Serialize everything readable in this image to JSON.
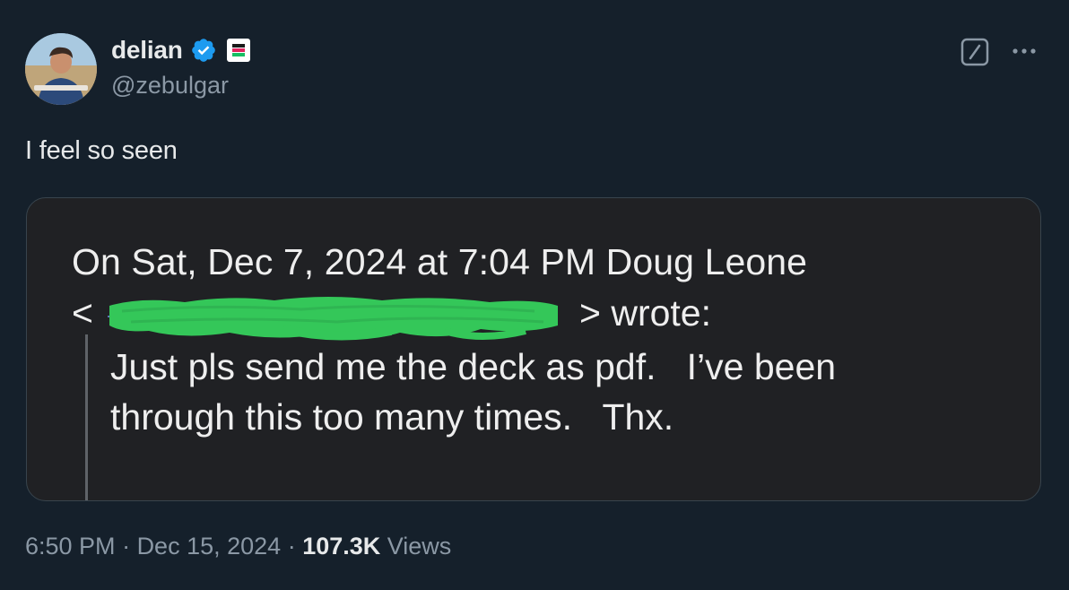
{
  "author": {
    "display_name": "delian",
    "handle": "@zebulgar",
    "verified_icon": "verified-badge-icon",
    "affiliate_icon": "affiliate-badge-icon",
    "avatar_icon": "avatar-photo"
  },
  "actions": {
    "grok_icon": "grok-icon",
    "more_icon": "more-options-icon"
  },
  "tweet": {
    "text": "I feel so seen"
  },
  "media": {
    "email_header": "On Sat, Dec 7, 2024 at 7:04 PM Doug Leone",
    "email_lt": "<",
    "email_gt_wrote": "> wrote:",
    "quote_line_1": "Just pls send me the deck as pdf.   I’ve been",
    "quote_line_2": "through this too many times.   Thx."
  },
  "footer": {
    "time": "6:50 PM",
    "sep1": " · ",
    "date": "Dec 15, 2024",
    "sep2": " · ",
    "views_count": "107.3K",
    "views_label": " Views"
  },
  "colors": {
    "background": "#15202b",
    "primary_text": "#e7e9ea",
    "secondary_text": "#8b98a5",
    "verified_blue": "#1d9bf0",
    "redaction_green": "#34c759",
    "card_bg": "#202124"
  }
}
